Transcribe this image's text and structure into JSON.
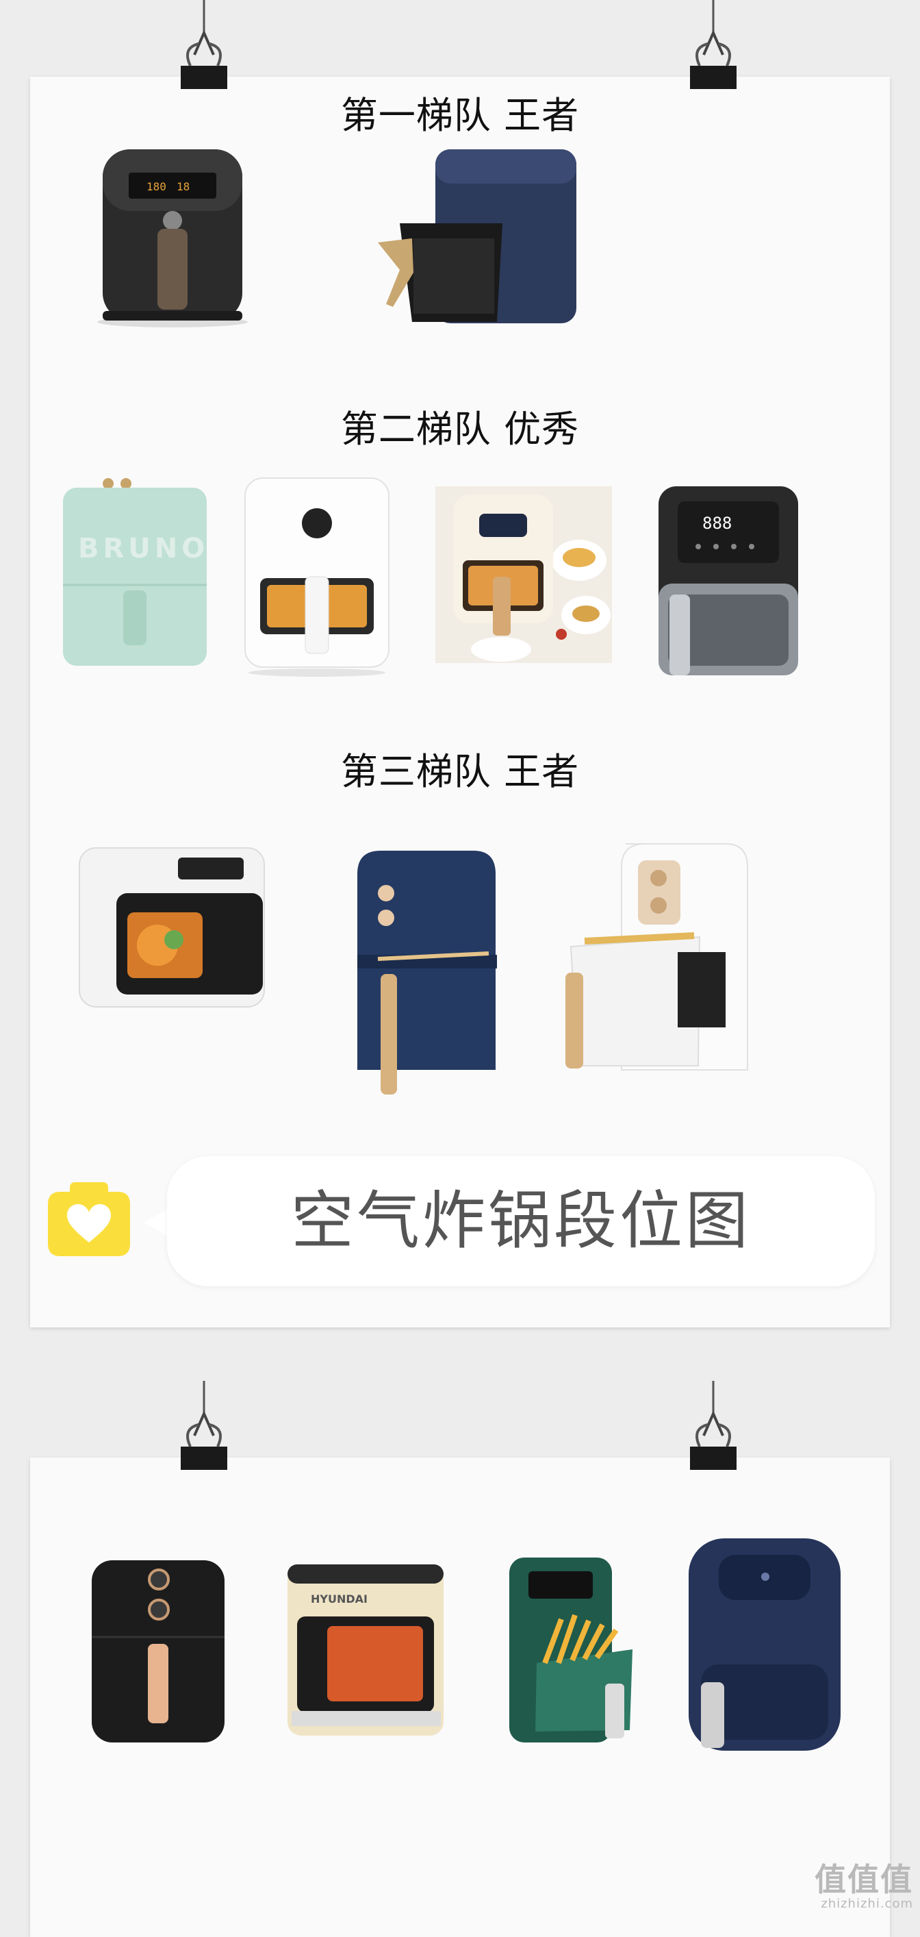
{
  "tiers": [
    {
      "title": "第一梯队 王者",
      "items": [
        "philips-black-air-fryer",
        "navy-air-fryer-basket-open"
      ]
    },
    {
      "title": "第二梯队 优秀",
      "items": [
        "bruno-mint-air-fryer",
        "white-window-air-fryer",
        "cream-air-fryer-with-food",
        "black-steel-digital-air-fryer"
      ]
    },
    {
      "title": "第三梯队 王者",
      "items": [
        "white-visual-air-fryer",
        "navy-dial-air-fryer",
        "white-dial-air-fryer-basket-open"
      ]
    }
  ],
  "banner": {
    "text": "空气炸锅段位图"
  },
  "bruno_label": "BRUNO",
  "digital_readout": "888",
  "second_board_items": [
    "black-dial-air-fryer",
    "hyundai-visual-air-fryer",
    "green-hyundai-air-fryer",
    "navy-round-air-fryer"
  ],
  "hyundai_label": "HYUNDAI",
  "watermark": {
    "logo": "值值值",
    "url": "zhizhizhi.com"
  },
  "colors": {
    "background": "#ededed",
    "board": "#fafafa",
    "camera_icon": "#fadf3c",
    "banner_text": "#555555"
  }
}
